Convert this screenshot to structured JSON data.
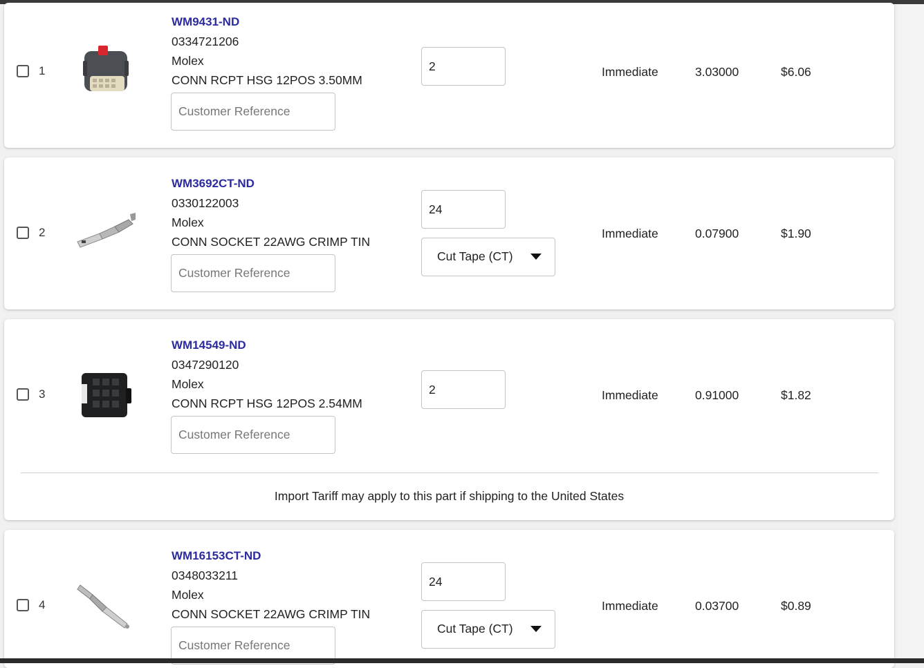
{
  "items": [
    {
      "index": "1",
      "part_number": "WM9431-ND",
      "mfr_part": "0334721206",
      "manufacturer": "Molex",
      "description": "CONN RCPT HSG 12POS 3.50MM",
      "customer_ref_placeholder": "Customer Reference",
      "quantity": "2",
      "availability": "Immediate",
      "unit_price": "3.03000",
      "extended_price": "$6.06",
      "thumb_icon": "connector-housing-gray-icon"
    },
    {
      "index": "2",
      "part_number": "WM3692CT-ND",
      "mfr_part": "0330122003",
      "manufacturer": "Molex",
      "description": "CONN SOCKET 22AWG CRIMP TIN",
      "customer_ref_placeholder": "Customer Reference",
      "quantity": "24",
      "packaging": "Cut Tape (CT)",
      "availability": "Immediate",
      "unit_price": "0.07900",
      "extended_price": "$1.90",
      "thumb_icon": "crimp-socket-icon"
    },
    {
      "index": "3",
      "part_number": "WM14549-ND",
      "mfr_part": "0347290120",
      "manufacturer": "Molex",
      "description": "CONN RCPT HSG 12POS 2.54MM",
      "customer_ref_placeholder": "Customer Reference",
      "quantity": "2",
      "availability": "Immediate",
      "unit_price": "0.91000",
      "extended_price": "$1.82",
      "note": "Import Tariff may apply to this part if shipping to the United States",
      "thumb_icon": "connector-housing-black-icon"
    },
    {
      "index": "4",
      "part_number": "WM16153CT-ND",
      "mfr_part": "0348033211",
      "manufacturer": "Molex",
      "description": "CONN SOCKET 22AWG CRIMP TIN",
      "customer_ref_placeholder": "Customer Reference",
      "quantity": "24",
      "packaging": "Cut Tape (CT)",
      "availability": "Immediate",
      "unit_price": "0.03700",
      "extended_price": "$0.89",
      "thumb_icon": "crimp-pin-icon"
    }
  ],
  "colors": {
    "part_link": "#2b2ba0",
    "card_bg": "#ffffff",
    "page_bg": "#f1f1f1"
  }
}
